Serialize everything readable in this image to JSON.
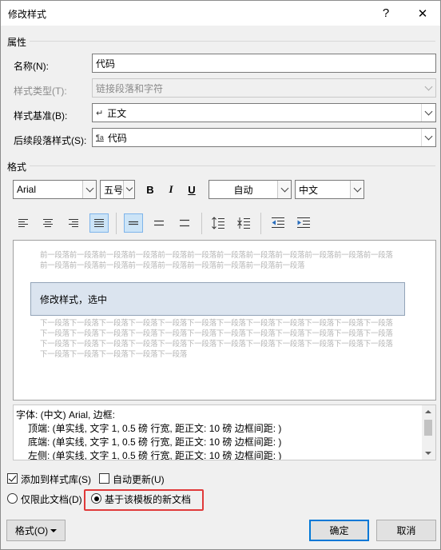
{
  "window": {
    "title": "修改样式",
    "help_glyph": "?",
    "close_glyph": "✕"
  },
  "properties": {
    "section_label": "属性",
    "name": {
      "label": "名称(N):",
      "value": "代码"
    },
    "style_type": {
      "label": "样式类型(T):",
      "value": "链接段落和字符"
    },
    "based_on": {
      "label": "样式基准(B):",
      "value": "正文",
      "glyph": "↵"
    },
    "next_style": {
      "label": "后续段落样式(S):",
      "value": "代码",
      "glyph": "¶a"
    }
  },
  "format": {
    "section_label": "格式",
    "font": "Arial",
    "size": "五号",
    "bold": "B",
    "italic": "I",
    "underline": "U",
    "color": "自动",
    "script": "中文"
  },
  "preview": {
    "before_text": "前一段落前一段落前一段落前一段落前一段落前一段落前一段落前一段落前一段落前一段落前一段落前一段落前一段落前一段落前一段落前一段落前一段落前一段落前一段落前一段落前一段落",
    "sample_text": "修改样式，选中",
    "after_text": "下一段落下一段落下一段落下一段落下一段落下一段落下一段落下一段落下一段落下一段落下一段落下一段落下一段落下一段落下一段落下一段落下一段落下一段落下一段落下一段落下一段落下一段落下一段落下一段落下一段落下一段落下一段落下一段落下一段落下一段落下一段落下一段落下一段落下一段落下一段落下一段落下一段落下一段落下一段落下一段落下一段落"
  },
  "description": {
    "lines": [
      "字体: (中文) Arial, 边框:",
      "顶端: (单实线, 文字 1,  0.5 磅 行宽, 距正文:  10 磅 边框间距: )",
      "底端: (单实线, 文字 1,  0.5 磅 行宽, 距正文:  10 磅 边框间距: )",
      "左侧: (单实线, 文字 1,  0.5 磅 行宽, 距正文:  10 磅 边框间距: )"
    ]
  },
  "options": {
    "add_to_gallery": {
      "label": "添加到样式库(S)",
      "checked": true
    },
    "auto_update": {
      "label": "自动更新(U)",
      "checked": false
    },
    "this_document_only": {
      "label": "仅限此文档(D)",
      "selected": false
    },
    "new_documents_template": {
      "label": "基于该模板的新文档",
      "selected": true
    }
  },
  "buttons": {
    "format": "格式(O)",
    "ok": "确定",
    "cancel": "取消"
  },
  "colors": {
    "highlight": "#e03a3a",
    "accent": "#0078d7",
    "sample_fill": "#dbe4ef"
  }
}
